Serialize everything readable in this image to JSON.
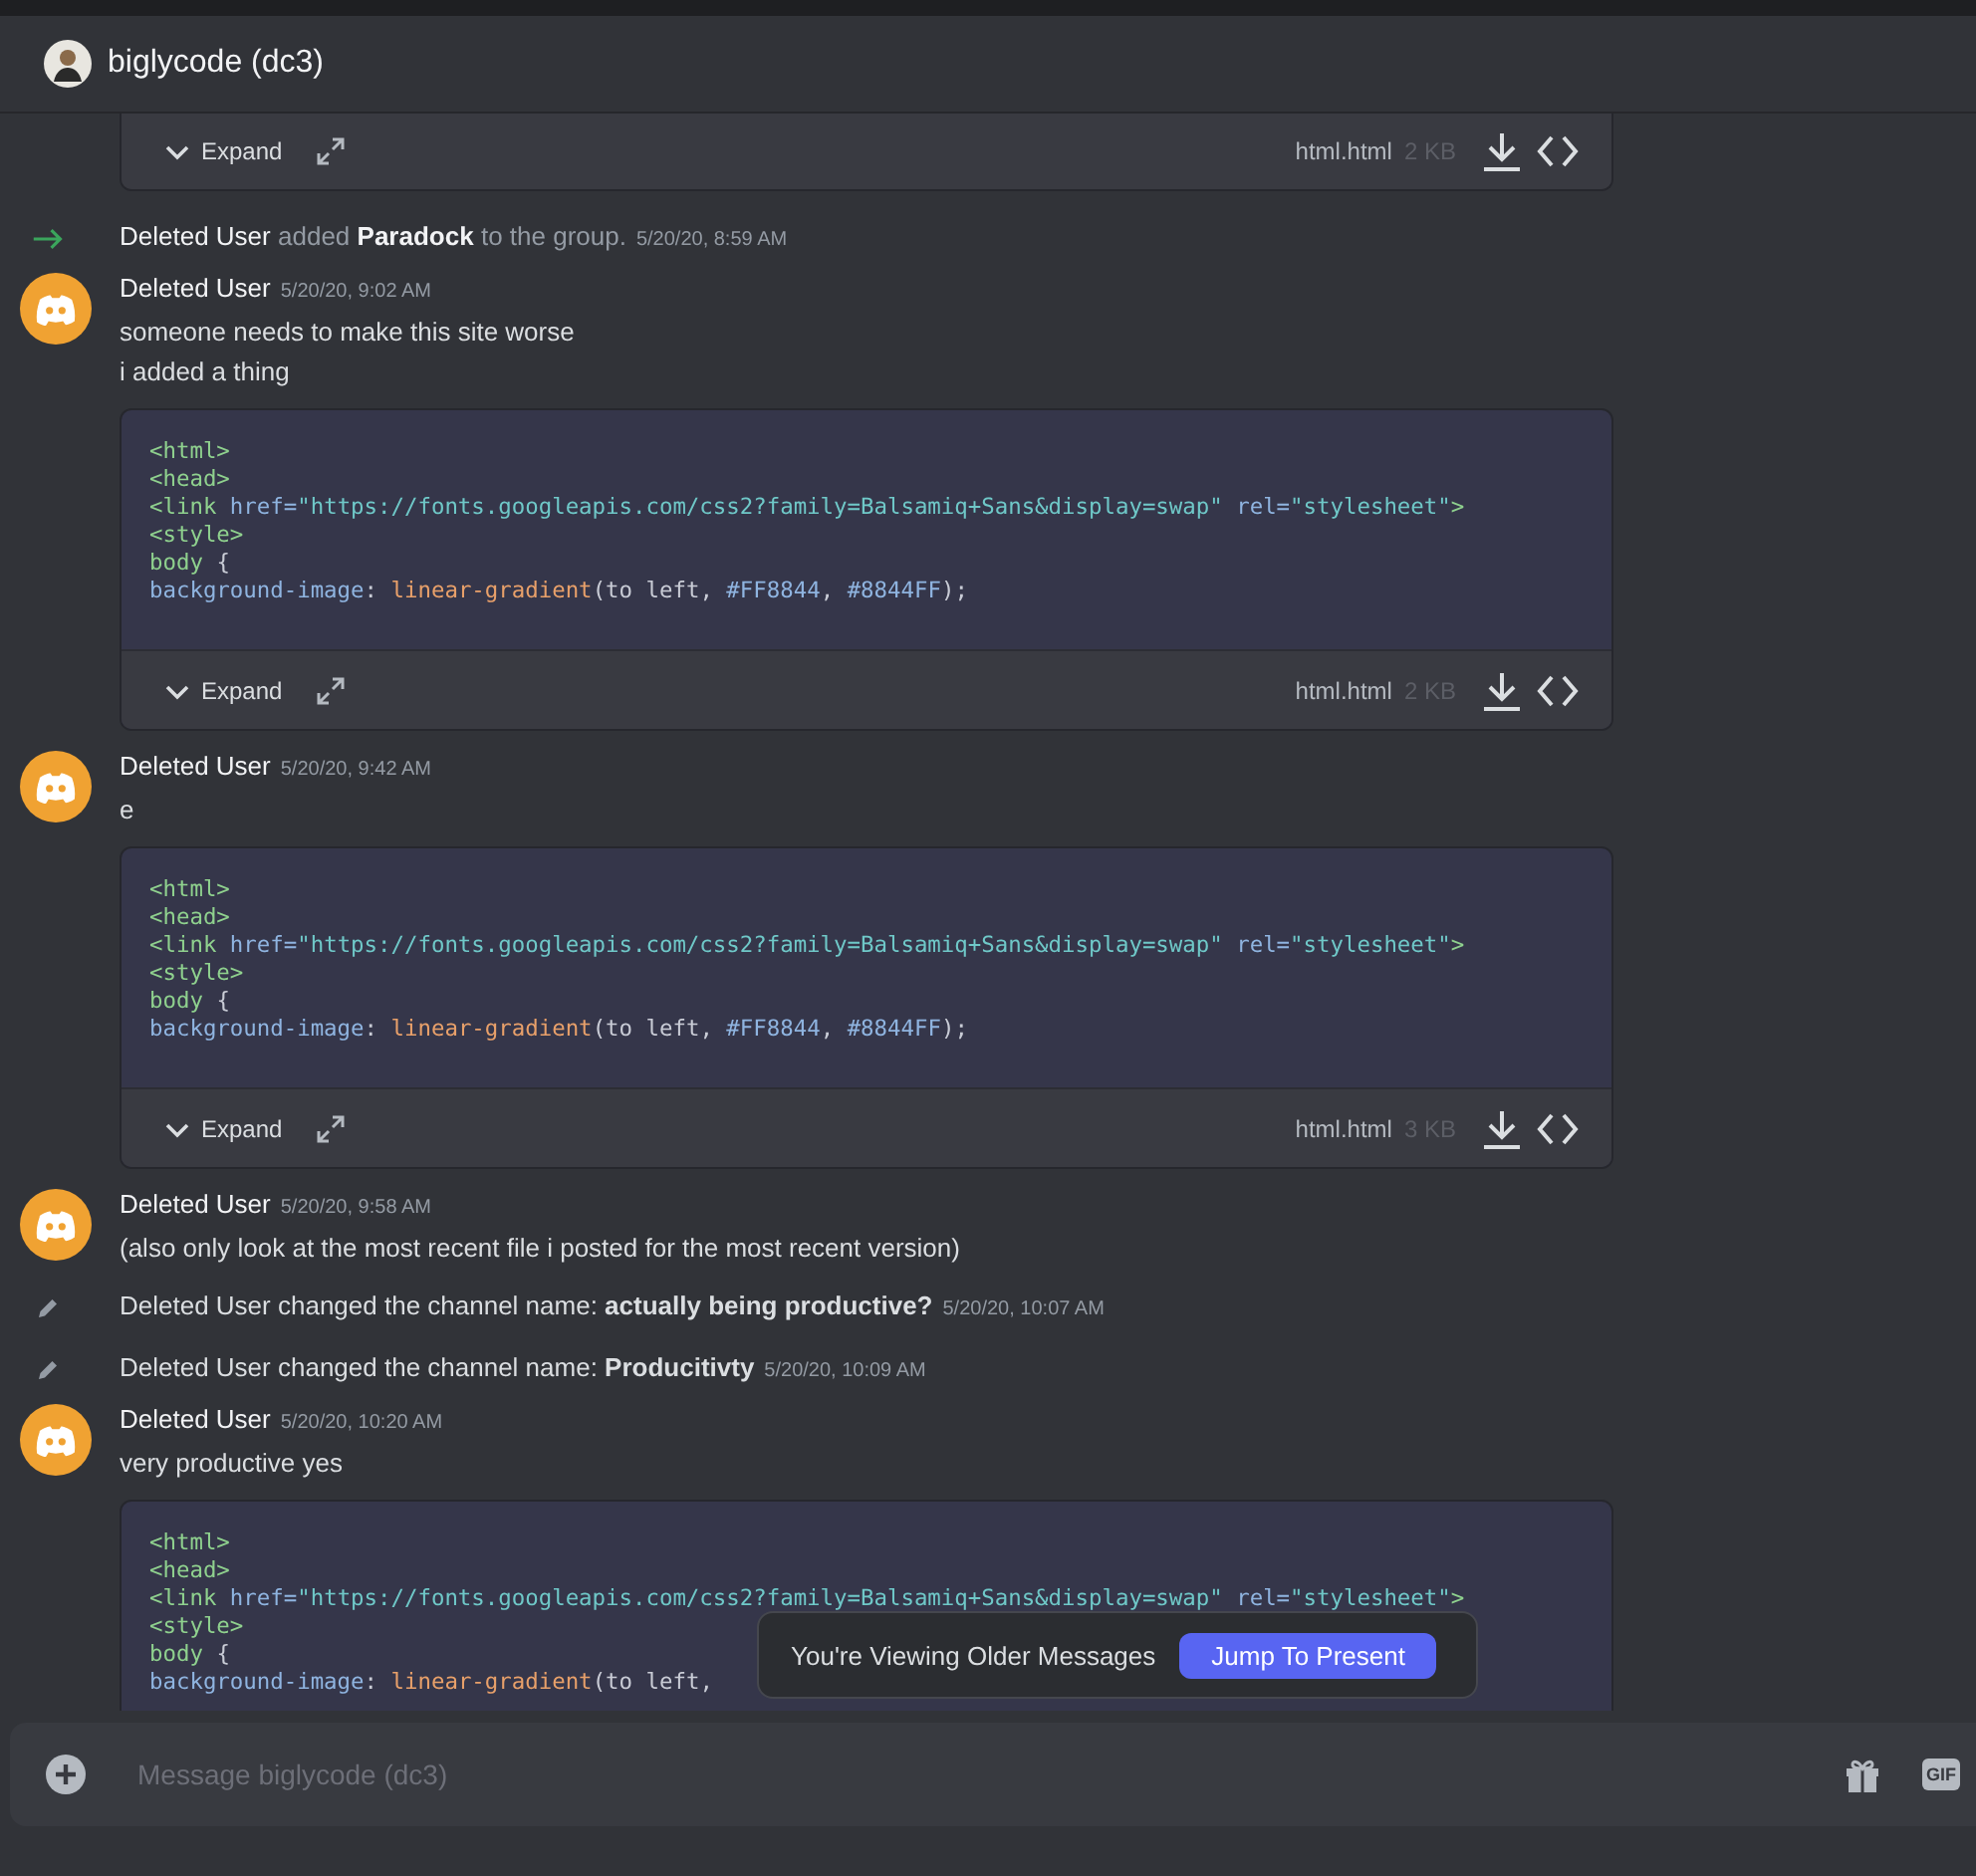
{
  "header": {
    "title": "biglycode (dc3)"
  },
  "feed": [
    {
      "kind": "file",
      "footer": {
        "expand": "Expand",
        "filename": "html.html",
        "size": "2 KB"
      }
    },
    {
      "kind": "join",
      "actor": "Deleted User",
      "verb": "added",
      "target": "Paradock",
      "rest": "to the group.",
      "time": "5/20/20, 8:59 AM"
    },
    {
      "kind": "message",
      "author": "Deleted User",
      "time": "5/20/20, 9:02 AM",
      "lines": [
        "someone needs to make this site worse",
        "i added a thing"
      ]
    },
    {
      "kind": "file",
      "code": [
        [
          {
            "t": "<html>",
            "kind": "tag"
          }
        ],
        [
          {
            "t": "<head>",
            "kind": "tag"
          }
        ],
        [
          {
            "t": "<link",
            "kind": "tag"
          },
          {
            "t": " href=",
            "kind": "attr"
          },
          {
            "t": "\"https://fonts.googleapis.com/css2?family=Balsamiq+Sans&display=swap\"",
            "kind": "string"
          },
          {
            "t": " rel=",
            "kind": "attr"
          },
          {
            "t": "\"stylesheet\"",
            "kind": "string"
          },
          {
            "t": ">",
            "kind": "tag"
          }
        ],
        [
          {
            "t": "<style>",
            "kind": "tag"
          }
        ],
        [
          {
            "t": "body",
            "kind": "tag"
          },
          {
            "t": " {",
            "kind": "plain"
          }
        ],
        [
          {
            "t": "background-image",
            "kind": "attr"
          },
          {
            "t": ": ",
            "kind": "plain"
          },
          {
            "t": "linear-gradient",
            "kind": "func"
          },
          {
            "t": "(to left, ",
            "kind": "plain"
          },
          {
            "t": "#FF8844",
            "kind": "attr"
          },
          {
            "t": ", ",
            "kind": "plain"
          },
          {
            "t": "#8844FF",
            "kind": "attr"
          },
          {
            "t": ");",
            "kind": "plain"
          }
        ]
      ],
      "footer": {
        "expand": "Expand",
        "filename": "html.html",
        "size": "2 KB"
      }
    },
    {
      "kind": "message",
      "author": "Deleted User",
      "time": "5/20/20, 9:42 AM",
      "lines": [
        "e"
      ]
    },
    {
      "kind": "file",
      "code": [
        [
          {
            "t": "<html>",
            "kind": "tag"
          }
        ],
        [
          {
            "t": "<head>",
            "kind": "tag"
          }
        ],
        [
          {
            "t": "<link",
            "kind": "tag"
          },
          {
            "t": " href=",
            "kind": "attr"
          },
          {
            "t": "\"https://fonts.googleapis.com/css2?family=Balsamiq+Sans&display=swap\"",
            "kind": "string"
          },
          {
            "t": " rel=",
            "kind": "attr"
          },
          {
            "t": "\"stylesheet\"",
            "kind": "string"
          },
          {
            "t": ">",
            "kind": "tag"
          }
        ],
        [
          {
            "t": "<style>",
            "kind": "tag"
          }
        ],
        [
          {
            "t": "body",
            "kind": "tag"
          },
          {
            "t": " {",
            "kind": "plain"
          }
        ],
        [
          {
            "t": "background-image",
            "kind": "attr"
          },
          {
            "t": ": ",
            "kind": "plain"
          },
          {
            "t": "linear-gradient",
            "kind": "func"
          },
          {
            "t": "(to left, ",
            "kind": "plain"
          },
          {
            "t": "#FF8844",
            "kind": "attr"
          },
          {
            "t": ", ",
            "kind": "plain"
          },
          {
            "t": "#8844FF",
            "kind": "attr"
          },
          {
            "t": ");",
            "kind": "plain"
          }
        ]
      ],
      "footer": {
        "expand": "Expand",
        "filename": "html.html",
        "size": "3 KB"
      }
    },
    {
      "kind": "message",
      "author": "Deleted User",
      "time": "5/20/20, 9:58 AM",
      "lines": [
        "(also only look at the most recent file i posted for the most recent version)"
      ]
    },
    {
      "kind": "rename",
      "text": "Deleted User changed the channel name: **actually being productive?**",
      "time": "5/20/20, 10:07 AM"
    },
    {
      "kind": "rename",
      "text": "Deleted User changed the channel name: **Producitivty**",
      "time": "5/20/20, 10:09 AM"
    },
    {
      "kind": "message",
      "author": "Deleted User",
      "time": "5/20/20, 10:20 AM",
      "lines": [
        "very productive yes"
      ]
    },
    {
      "kind": "file",
      "code": [
        [
          {
            "t": "<html>",
            "kind": "tag"
          }
        ],
        [
          {
            "t": "<head>",
            "kind": "tag"
          }
        ],
        [
          {
            "t": "<link",
            "kind": "tag"
          },
          {
            "t": " href=",
            "kind": "attr"
          },
          {
            "t": "\"https://fonts.googleapis.com/css2?family=Balsamiq+Sans&display=swap\"",
            "kind": "string"
          },
          {
            "t": " rel=",
            "kind": "attr"
          },
          {
            "t": "\"stylesheet\"",
            "kind": "string"
          },
          {
            "t": ">",
            "kind": "tag"
          }
        ],
        [
          {
            "t": "<style>",
            "kind": "tag"
          }
        ],
        [
          {
            "t": "body",
            "kind": "tag"
          },
          {
            "t": " {",
            "kind": "plain"
          }
        ],
        [
          {
            "t": "background-image",
            "kind": "attr"
          },
          {
            "t": ": ",
            "kind": "plain"
          },
          {
            "t": "linear-gradient",
            "kind": "func"
          },
          {
            "t": "(to left,",
            "kind": "plain"
          }
        ]
      ]
    }
  ],
  "notice": {
    "text": "You're Viewing Older Messages",
    "button": "Jump To Present"
  },
  "composer": {
    "placeholder": "Message biglycode (dc3)",
    "gif_label": "GIF"
  }
}
